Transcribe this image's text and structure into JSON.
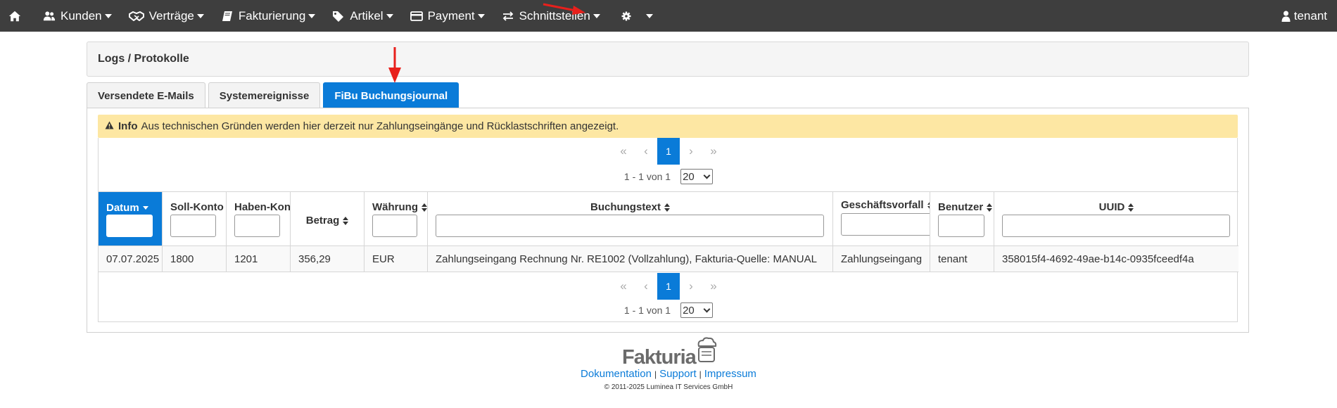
{
  "nav": {
    "items": [
      {
        "label": "Kunden",
        "icon": "users-icon"
      },
      {
        "label": "Verträge",
        "icon": "handshake-icon"
      },
      {
        "label": "Fakturierung",
        "icon": "book-icon"
      },
      {
        "label": "Artikel",
        "icon": "tags-icon"
      },
      {
        "label": "Payment",
        "icon": "credit-card-icon"
      },
      {
        "label": "Schnittstellen",
        "icon": "exchange-icon"
      }
    ],
    "user": "tenant"
  },
  "panel": {
    "title": "Logs / Protokolle"
  },
  "tabs": [
    "Versendete E-Mails",
    "Systemereignisse",
    "FiBu Buchungsjournal"
  ],
  "active_tab": "FiBu Buchungsjournal",
  "alert": {
    "title": "Info",
    "text": "Aus technischen Gründen werden hier derzeit nur Zahlungseingänge und Rücklastschriften angezeigt."
  },
  "pager": {
    "current": "1",
    "info": "1 - 1 von 1",
    "page_size": "20"
  },
  "table": {
    "columns": [
      "Datum",
      "Soll-Konto",
      "Haben-Kon",
      "Betrag",
      "Währung",
      "Buchungstext",
      "Geschäftsvorfall",
      "Benutzer",
      "UUID"
    ],
    "rows": [
      [
        "07.07.2025",
        "1800",
        "1201",
        "356,29",
        "EUR",
        "Zahlungseingang Rechnung Nr. RE1002 (Vollzahlung), Fakturia-Quelle: MANUAL",
        "Zahlungseingang",
        "tenant",
        "358015f4-4692-49ae-b14c-0935fceedf4a"
      ]
    ]
  },
  "footer": {
    "logo": "Fakturia",
    "links": [
      "Dokumentation",
      "Support",
      "Impressum"
    ],
    "copyright": "© 2011-2025 Luminea IT Services GmbH"
  },
  "colors": {
    "primary": "#0a7bd8",
    "navbar": "#3e3e3e",
    "alert": "#fde7a3",
    "annotation": "#e8201c"
  }
}
